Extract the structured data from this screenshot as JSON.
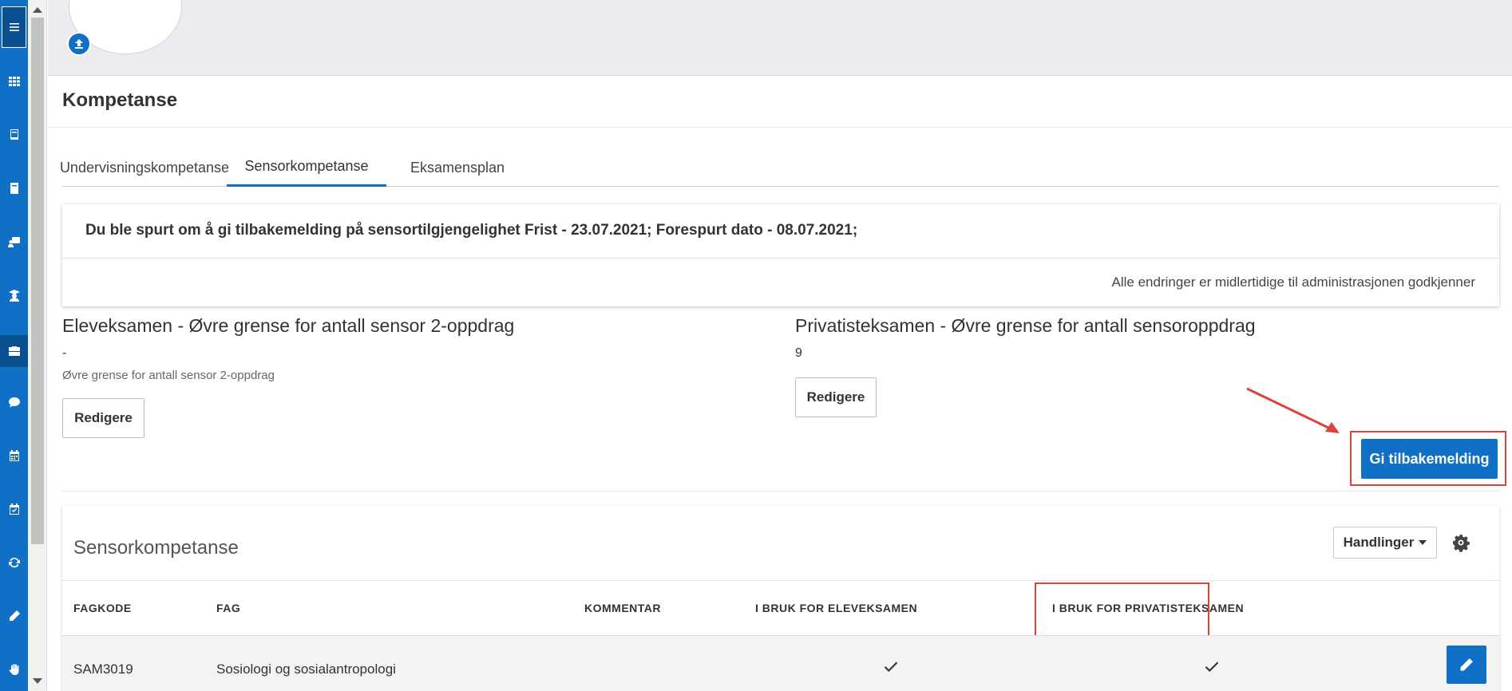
{
  "nav": {
    "items": [
      {
        "name": "menu-icon"
      },
      {
        "name": "apps-grid-icon"
      },
      {
        "name": "book-icon"
      },
      {
        "name": "notebook-icon"
      },
      {
        "name": "teacher-icon"
      },
      {
        "name": "graduate-icon"
      },
      {
        "name": "briefcase-icon"
      },
      {
        "name": "chat-icon"
      },
      {
        "name": "calendar-icon"
      },
      {
        "name": "calendar-check-icon"
      },
      {
        "name": "sync-icon"
      },
      {
        "name": "pencil-icon"
      },
      {
        "name": "hand-icon"
      }
    ]
  },
  "page": {
    "title": "Kompetanse"
  },
  "tabs": [
    {
      "label": "Undervisningskompetanse",
      "active": false
    },
    {
      "label": "Sensorkompetanse",
      "active": true
    },
    {
      "label": "Eksamensplan",
      "active": false
    }
  ],
  "notice": {
    "text": "Du ble spurt om å gi tilbakemelding på sensortilgjengelighet Frist - 23.07.2021; Forespurt dato - 08.07.2021;",
    "subtext": "Alle endringer er midlertidige til administrasjonen godkjenner"
  },
  "limits": {
    "elev": {
      "title": "Eleveksamen - Øvre grense for antall sensor 2-oppdrag",
      "value": "-",
      "help": "Øvre grense for antall sensor 2-oppdrag",
      "button": "Redigere"
    },
    "privatist": {
      "title": "Privatisteksamen - Øvre grense for antall sensoroppdrag",
      "value": "9",
      "button": "Redigere"
    }
  },
  "feedback_button": "Gi tilbakemelding",
  "table": {
    "title": "Sensorkompetanse",
    "actions_label": "Handlinger",
    "columns": [
      "FAGKODE",
      "FAG",
      "KOMMENTAR",
      "I BRUK FOR ELEVEKSAMEN",
      "I BRUK FOR PRIVATISTEKSAMEN"
    ],
    "rows": [
      {
        "fagkode": "SAM3019",
        "fag": "Sosiologi og sosialantropologi",
        "kommentar": "",
        "elev": true,
        "privatist": true
      }
    ]
  },
  "colors": {
    "primary": "#0f70c6",
    "highlight": "#e0403a"
  }
}
